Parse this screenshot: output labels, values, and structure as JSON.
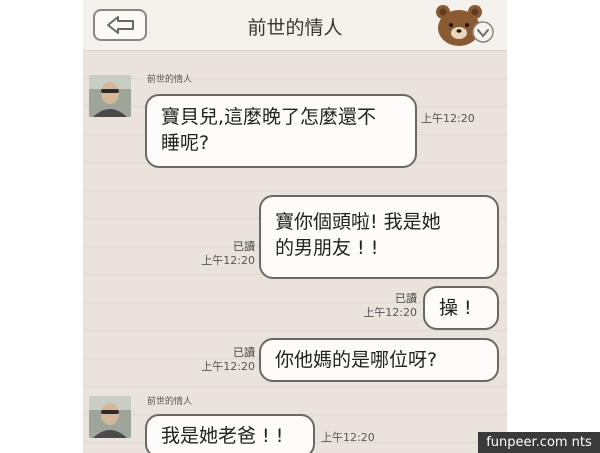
{
  "header": {
    "title": "前世的情人"
  },
  "icons": {
    "back": "back-arrow-icon",
    "sticker": "bear-sticker-icon",
    "dropdown": "chevron-down-icon"
  },
  "messages": [
    {
      "side": "left",
      "sender": "前世的情人",
      "text": "寶貝兒,這麼晚了怎麼還不\n睡呢?",
      "time": "上午12:20"
    },
    {
      "side": "right",
      "read": "已讀",
      "text": "寶你個頭啦! 我是她\n的男朋友 ! !",
      "time": "上午12:20"
    },
    {
      "side": "right",
      "read": "已讀",
      "text": "操 !",
      "time": "上午12:20"
    },
    {
      "side": "right",
      "read": "已讀",
      "text": "你他媽的是哪位呀?",
      "time": "上午12:20"
    },
    {
      "side": "left",
      "sender": "前世的情人",
      "text": "我是她老爸 ! !",
      "time": "上午12:20"
    }
  ],
  "watermark": "funpeer.com nts",
  "colors": {
    "background": "#e9e3dc",
    "header": "#f5f1ec",
    "bubble": "#fdfcfa",
    "bubble_border": "#6d6862"
  }
}
